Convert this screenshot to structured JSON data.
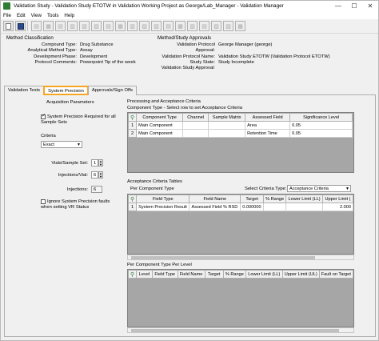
{
  "window": {
    "title": "Validation Study - Validation Study ETOTW in Validation Working Project as George/Lab_Manager - Validation Manager",
    "controls": {
      "minimize": "—",
      "maximize": "☐",
      "close": "✕"
    }
  },
  "menu": [
    "File",
    "Edit",
    "View",
    "Tools",
    "Help"
  ],
  "method_classification": {
    "title": "Method Classification",
    "rows": [
      {
        "label": "Compound Type:",
        "value": "Drug Substance"
      },
      {
        "label": "Analytical Method Type:",
        "value": "Assay"
      },
      {
        "label": "Development Phase:",
        "value": "Development"
      },
      {
        "label": "Protocol Comments:",
        "value": "Powerpoint Tip of the week"
      }
    ]
  },
  "method_study_approvals": {
    "title": "Method/Study Approvals",
    "rows": [
      {
        "label": "Validation Protocol Approval:",
        "value": "George Manager (george)"
      },
      {
        "label": "Validation Protocol Name:",
        "value": "Validation Study ETOTW (Validation Protocol ETOTW)"
      },
      {
        "label": "Study State:",
        "value": "Study Incomplete"
      },
      {
        "label": "Validation Study Approval:",
        "value": ""
      }
    ]
  },
  "tabs": [
    {
      "label": "Validation Tests",
      "active": false
    },
    {
      "label": "System Precision",
      "active": true
    },
    {
      "label": "Approvals/Sign Offs",
      "active": false
    }
  ],
  "acquisition": {
    "title": "Acquisition Parameters",
    "sys_prec_required_label": "System Precision Required for all Sample Sets",
    "sys_prec_required_checked": true,
    "criteria_label": "Criteria",
    "criteria_value": "Exact",
    "vials_label": "Vials/Sample Set:",
    "vials_value": "1",
    "inj_vial_label": "Injections/Vial:",
    "inj_vial_value": "6",
    "injections_label": "Injections:",
    "injections_value": "6",
    "ignore_label": "Ignore System Precision faults when setting VR Status",
    "ignore_checked": false
  },
  "processing": {
    "title": "Processing and Acceptance Criteria",
    "subtitle": "Component Type - Select row to set Acceptance Criteria",
    "headers": [
      "Component Type",
      "Channel",
      "Sample Matrix",
      "Assessed Field",
      "Significance Level"
    ],
    "rows": [
      {
        "n": "1",
        "cells": [
          "Main Component",
          "",
          "",
          "Area",
          "0.05"
        ]
      },
      {
        "n": "2",
        "cells": [
          "Main Component",
          "",
          "",
          "Retention Time",
          "0.05"
        ]
      }
    ]
  },
  "acceptance": {
    "title": "Acceptance Criteria Tables",
    "per_component_label": "Per Component Type",
    "select_label": "Select",
    "criteria_type_label": "Criteria Type:",
    "criteria_type_value": "Acceptance Criteria",
    "headers": [
      "Field Type",
      "Field Name",
      "Target",
      "% Range",
      "Lower Limit (LL)",
      "Upper Limit ("
    ],
    "rows": [
      {
        "n": "1",
        "cells": [
          "System Precision Result",
          "Assessed Field % RSD",
          "0.000000",
          "",
          "",
          "2.000"
        ]
      }
    ]
  },
  "per_level": {
    "title": "Per Component Type Per Level",
    "headers": [
      "Level",
      "Field Type",
      "Field Name",
      "Target",
      "% Range",
      "Lower Limit (LL)",
      "Upper Limit (UL)",
      "Fault on Target"
    ]
  }
}
